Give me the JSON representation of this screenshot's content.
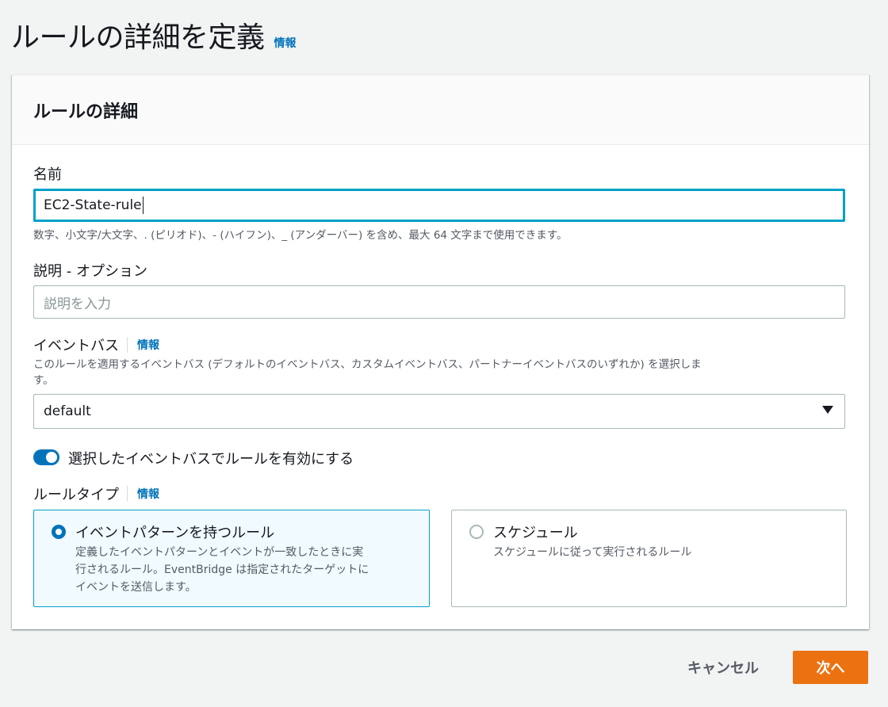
{
  "page": {
    "title": "ルールの詳細を定義",
    "info": "情報"
  },
  "panel": {
    "title": "ルールの詳細"
  },
  "name_field": {
    "label": "名前",
    "value": "EC2-State-rule",
    "hint": "数字、小文字/大文字、. (ピリオド)、- (ハイフン)、_ (アンダーバー) を含め、最大 64 文字まで使用できます。"
  },
  "description_field": {
    "label": "説明 - オプション",
    "placeholder": "説明を入力"
  },
  "event_bus": {
    "label": "イベントバス",
    "info": "情報",
    "hint_line1": "このルールを適用するイベントバス (デフォルトのイベントバス、カスタムイベントバス、パートナーイベントバスのいずれか) を選択しま",
    "hint_line2": "す。",
    "selected": "default"
  },
  "toggle": {
    "label": "選択したイベントバスでルールを有効にする",
    "enabled": true
  },
  "rule_type": {
    "label": "ルールタイプ",
    "info": "情報",
    "options": [
      {
        "title": "イベントパターンを持つルール",
        "desc_line1": "定義したイベントパターンとイベントが一致したときに実",
        "desc_line2": "行されるルール。EventBridge は指定されたターゲットに",
        "desc_line3": "イベントを送信します。",
        "selected": true
      },
      {
        "title": "スケジュール",
        "desc_line1": "スケジュールに従って実行されるルール",
        "selected": false
      }
    ]
  },
  "footer": {
    "cancel": "キャンセル",
    "next": "次へ"
  },
  "colors": {
    "accent": "#0073bb",
    "primary_button": "#ec7211",
    "focus": "#00a1c9"
  }
}
